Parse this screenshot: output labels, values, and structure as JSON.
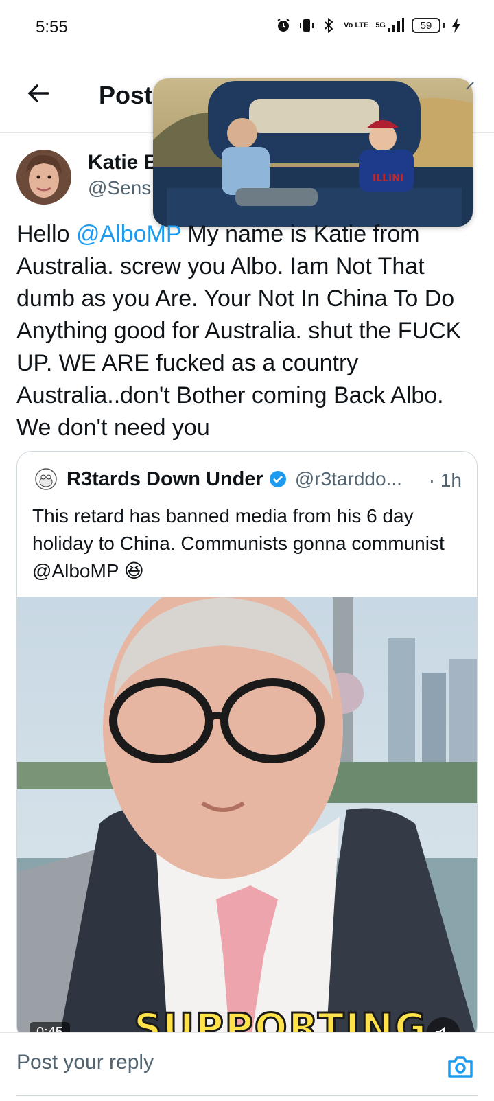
{
  "status_bar": {
    "time": "5:55",
    "network": "5G",
    "volte": "Vo LTE",
    "battery": "59",
    "icons": [
      "alarm-icon",
      "vibrate-icon",
      "bluetooth-icon",
      "volte-icon",
      "signal-icon",
      "battery-icon",
      "charging-icon"
    ]
  },
  "header": {
    "title": "Post",
    "back_icon": "arrow-left-icon"
  },
  "post": {
    "author_name": "Katie B",
    "author_handle": "@Sens",
    "text_before_mention": "Hello ",
    "mention": "@AlboMP",
    "text_after_mention": " My name is Katie from Australia. screw you Albo. Iam Not That dumb as you Are. Your Not In China To Do Anything good  for Australia. shut the FUCK UP. WE ARE fucked as a country Australia..don't Bother coming Back Albo. We don't need you"
  },
  "quoted_post": {
    "author_name": "R3tards Down Under",
    "verified": true,
    "author_handle": "@r3tarddo...",
    "time": "· 1h",
    "text": "This retard has banned media from his 6 day holiday to China. Communists gonna communist @AlboMP 😆",
    "video": {
      "duration": "0:45",
      "caption": "SUPPORTING",
      "mute_icon": "speaker-muted-icon"
    }
  },
  "reply": {
    "placeholder": "Post your reply",
    "camera_icon": "camera-icon"
  },
  "colors": {
    "accent": "#1d9bf0",
    "text_primary": "#0f1419",
    "text_secondary": "#536471",
    "border": "#cfd9de"
  }
}
